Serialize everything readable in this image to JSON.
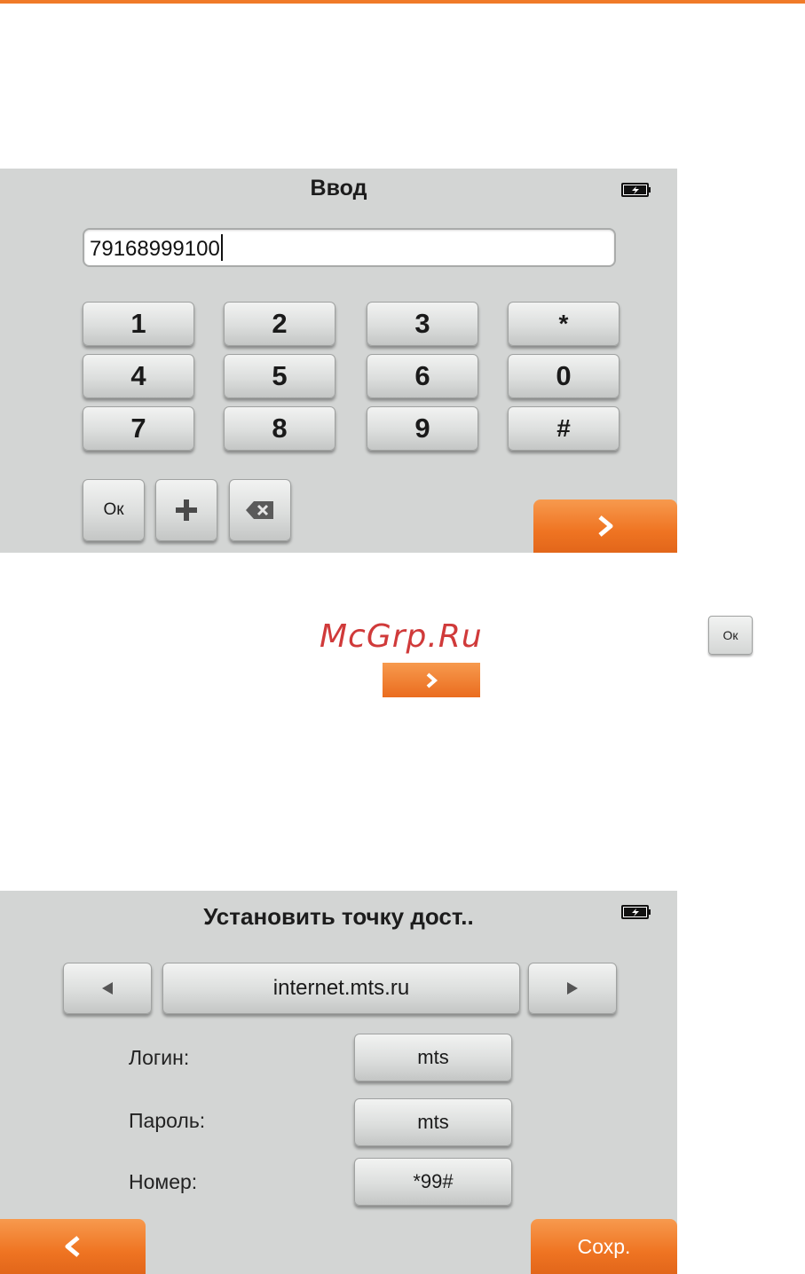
{
  "colors": {
    "accent": "#f07a28",
    "screen_bg": "#d3d5d4",
    "watermark": "#d03a3a"
  },
  "screen1": {
    "title": "Ввод",
    "input_value": "79168999100",
    "keys": [
      "1",
      "2",
      "3",
      "*",
      "4",
      "5",
      "6",
      "0",
      "7",
      "8",
      "9",
      "#"
    ],
    "ok_label": "Ок",
    "plus_icon": "plus-icon",
    "backspace_icon": "backspace-icon",
    "next_icon": "chevron-right-icon"
  },
  "watermark": "McGrp.Ru",
  "inline_ok_label": "Ок",
  "screen2": {
    "title": "Установить точку дост..",
    "apn_value": "internet.mts.ru",
    "login_label": "Логин:",
    "login_value": "mts",
    "password_label": "Пароль:",
    "password_value": "mts",
    "number_label": "Номер:",
    "number_value": "*99#",
    "back_icon": "chevron-left-icon",
    "save_label": "Сохр."
  }
}
